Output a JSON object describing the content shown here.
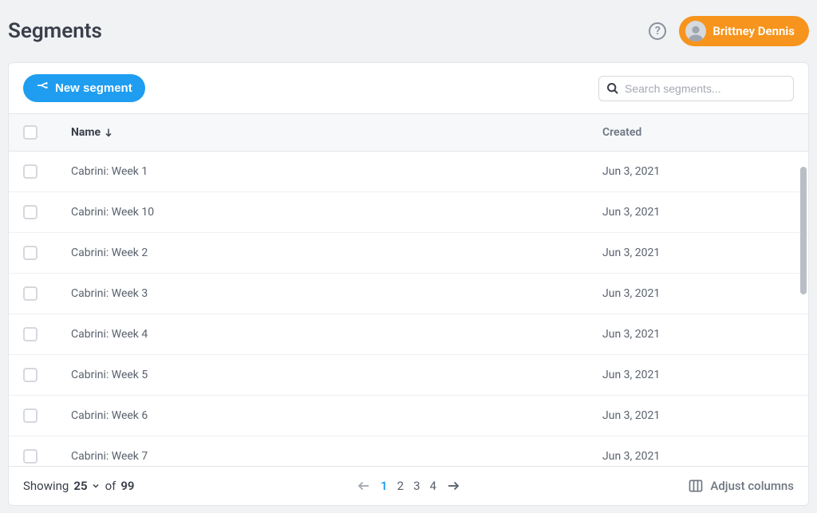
{
  "page": {
    "title": "Segments",
    "user_name": "Brittney Dennis"
  },
  "toolbar": {
    "new_segment_label": "New segment",
    "search_placeholder": "Search segments..."
  },
  "table": {
    "columns": {
      "name": "Name",
      "created": "Created"
    },
    "rows": [
      {
        "name": "Cabrini: Week 1",
        "created": "Jun 3, 2021"
      },
      {
        "name": "Cabrini: Week 10",
        "created": "Jun 3, 2021"
      },
      {
        "name": "Cabrini: Week 2",
        "created": "Jun 3, 2021"
      },
      {
        "name": "Cabrini: Week 3",
        "created": "Jun 3, 2021"
      },
      {
        "name": "Cabrini: Week 4",
        "created": "Jun 3, 2021"
      },
      {
        "name": "Cabrini: Week 5",
        "created": "Jun 3, 2021"
      },
      {
        "name": "Cabrini: Week 6",
        "created": "Jun 3, 2021"
      },
      {
        "name": "Cabrini: Week 7",
        "created": "Jun 3, 2021"
      }
    ]
  },
  "footer": {
    "showing_label": "Showing",
    "page_size": "25",
    "of_label": "of",
    "total": "99",
    "pages": [
      "1",
      "2",
      "3",
      "4"
    ],
    "current_page": "1",
    "adjust_columns_label": "Adjust columns"
  }
}
